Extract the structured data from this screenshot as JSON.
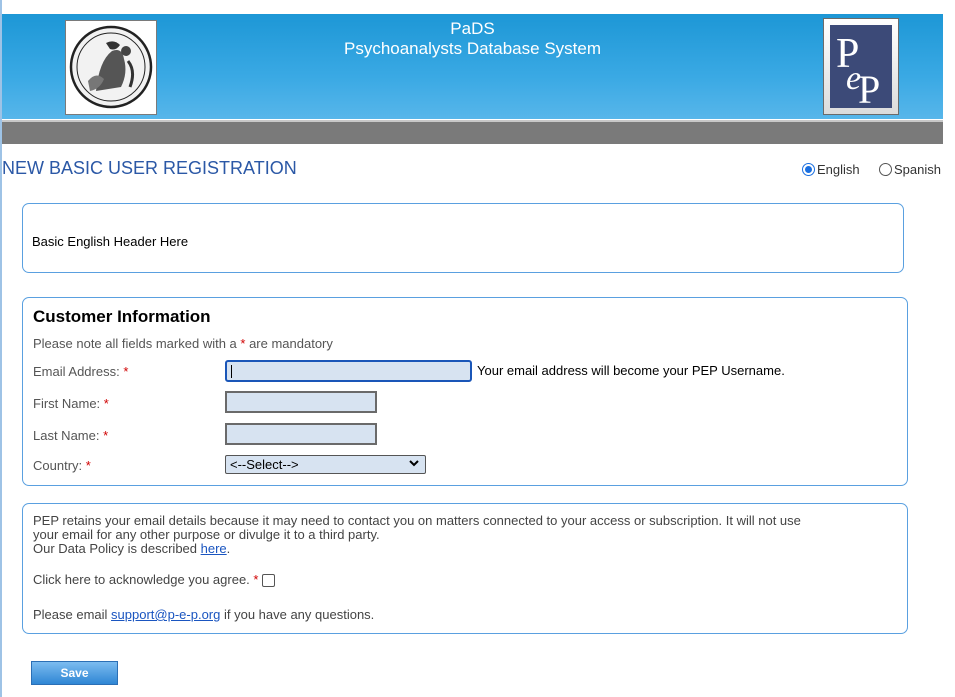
{
  "header": {
    "app_name": "PaDS",
    "app_subtitle": "Psychoanalysts Database System",
    "logo_left": "psychoanalysis-emblem-logo",
    "logo_right": "PEP-logo"
  },
  "page_title": "NEW BASIC USER REGISTRATION",
  "language": {
    "options": [
      "English",
      "Spanish"
    ],
    "selected": "English"
  },
  "intro_box": {
    "text": "Basic English Header Here"
  },
  "customer_info": {
    "title": "Customer Information",
    "note_before": "Please note all fields marked with a ",
    "note_star": "*",
    "note_after": " are mandatory",
    "fields": {
      "email": {
        "label": "Email Address:",
        "value": "",
        "hint": "Your email address will become your PEP Username."
      },
      "first_name": {
        "label": "First Name:",
        "value": ""
      },
      "last_name": {
        "label": "Last Name:",
        "value": ""
      },
      "country": {
        "label": "Country:",
        "selected": "<--Select-->"
      }
    },
    "required_mark": "*"
  },
  "policy": {
    "text_line1": "PEP retains your email details because it may need to contact you on matters connected to your access or subscription. It will not use",
    "text_line2": "your email for any other purpose or divulge it to a third party.",
    "data_policy_prefix": "Our Data Policy is described ",
    "data_policy_link": "here",
    "data_policy_suffix": ".",
    "acknowledge_label": "Click here to acknowledge you agree.",
    "acknowledge_checked": false,
    "contact_prefix": "Please email ",
    "contact_link": "support@p-e-p.org",
    "contact_suffix": " if you have any questions."
  },
  "actions": {
    "save_label": "Save"
  },
  "colors": {
    "banner": "#1d97d6",
    "title": "#2b58a6",
    "box_border": "#5aa0e0",
    "required": "#d00000",
    "link": "#1a55c0"
  }
}
